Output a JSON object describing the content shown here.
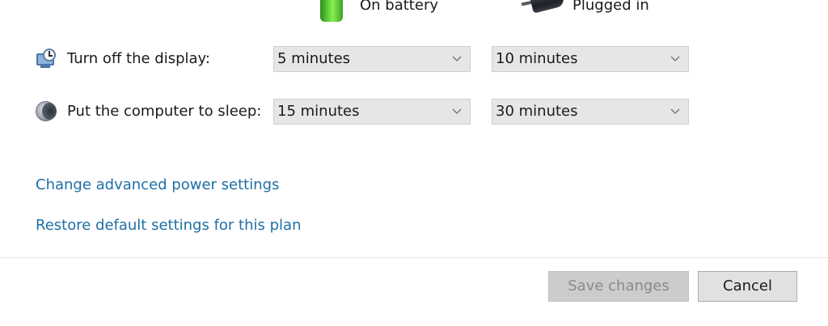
{
  "columns": {
    "battery": {
      "label": "On battery",
      "icon": "battery-icon"
    },
    "plugged": {
      "label": "Plugged in",
      "icon": "power-plug-icon"
    }
  },
  "settings": [
    {
      "label": "Turn off the display:",
      "icon": "monitor-timer-icon",
      "on_battery": "5 minutes",
      "plugged_in": "10 minutes"
    },
    {
      "label": "Put the computer to sleep:",
      "icon": "sleep-moon-icon",
      "on_battery": "15 minutes",
      "plugged_in": "30 minutes"
    }
  ],
  "links": {
    "advanced": "Change advanced power settings",
    "restore": "Restore default settings for this plan"
  },
  "buttons": {
    "save": "Save changes",
    "save_enabled": false,
    "cancel": "Cancel"
  },
  "colors": {
    "link": "#1e6fa6",
    "battery_green": "#5fd23a",
    "dropdown_bg": "#e6e6e6",
    "disabled_button_bg": "#cccccc"
  }
}
